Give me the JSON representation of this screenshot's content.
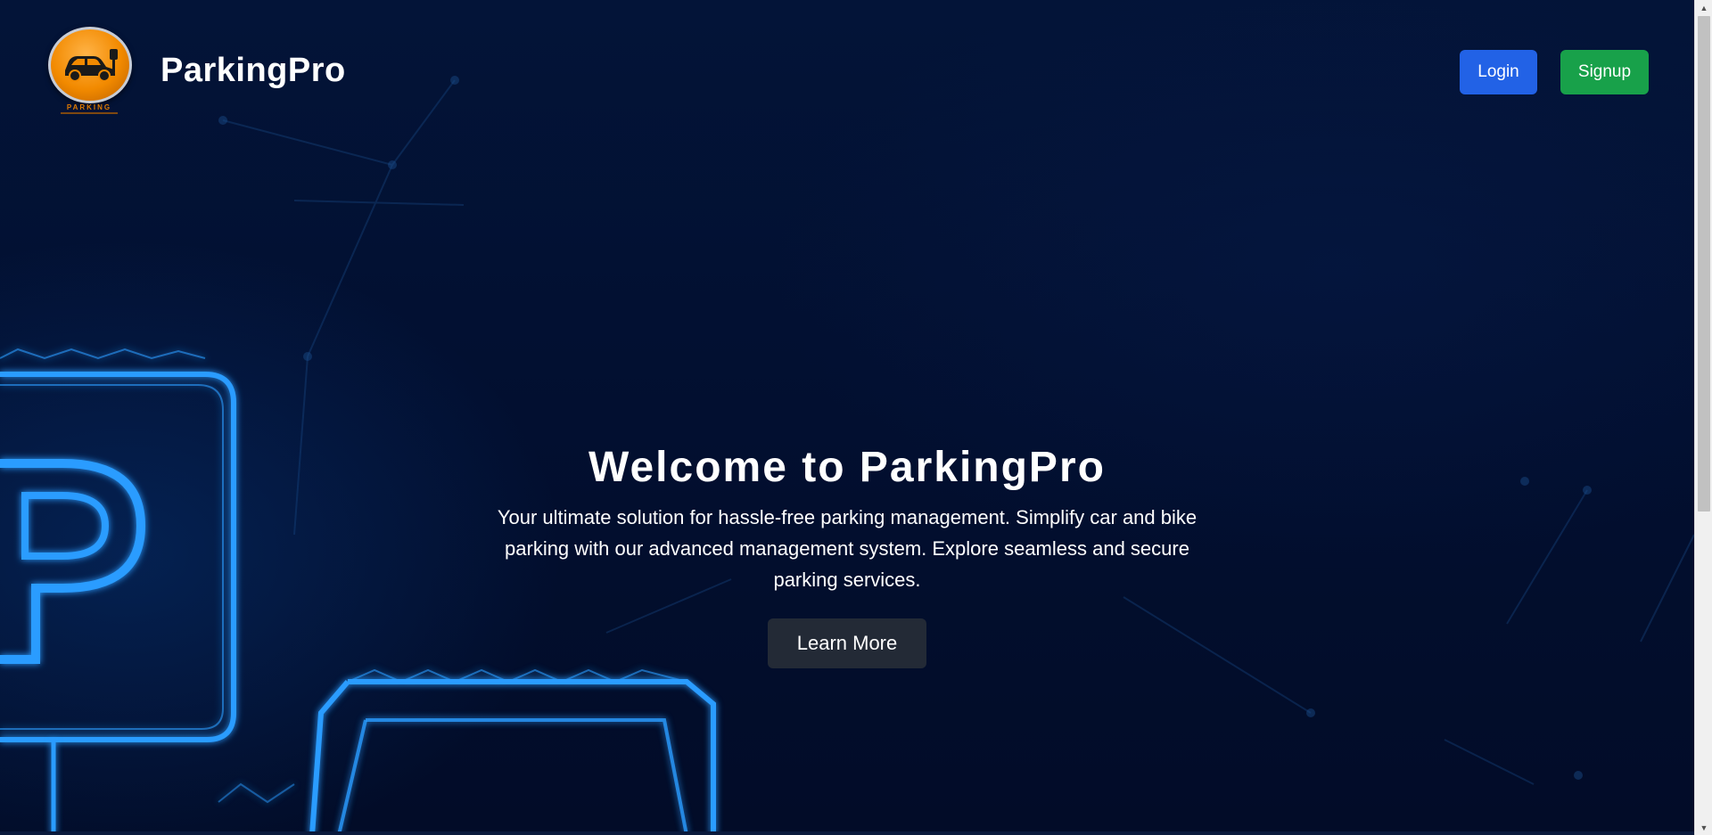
{
  "app": {
    "brand_name": "ParkingPro",
    "logo_text": "PARKING"
  },
  "header": {
    "login_label": "Login",
    "signup_label": "Signup"
  },
  "hero": {
    "title": "Welcome to ParkingPro",
    "description": "Your ultimate solution for hassle-free parking management. Simplify car and bike parking with our advanced management system. Explore seamless and secure parking services.",
    "cta_label": "Learn More"
  },
  "colors": {
    "background": "#020d2a",
    "login_button": "#2262e6",
    "signup_button": "#18a14a",
    "cta_button": "#232a36",
    "logo_orange": "#f28a00",
    "neon_blue": "#1e8fff"
  },
  "icons": {
    "logo": "car-key-icon",
    "background_art": "parking-sign-icon"
  }
}
